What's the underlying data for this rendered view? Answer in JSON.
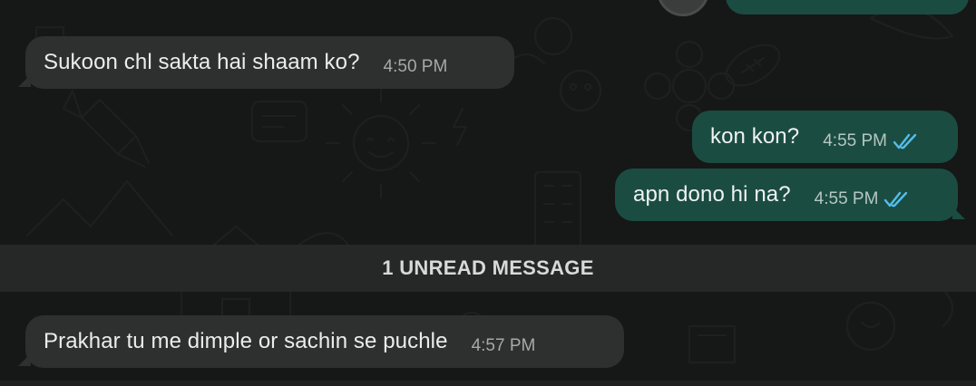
{
  "colors": {
    "background": "#161717",
    "incoming_bubble": "#2e2f2f",
    "outgoing_bubble": "#1b4c42",
    "read_ticks": "#53bdeb",
    "unread_bar": "#262828"
  },
  "messages": [
    {
      "direction": "incoming",
      "text": "Sukoon chl sakta hai shaam ko?",
      "time": "4:50 PM"
    },
    {
      "direction": "outgoing",
      "text": "kon kon?",
      "time": "4:55 PM",
      "status": "read"
    },
    {
      "direction": "outgoing",
      "text": "apn dono hi na?",
      "time": "4:55 PM",
      "status": "read"
    },
    {
      "direction": "incoming",
      "text": "Prakhar tu me dimple or sachin se puchle",
      "time": "4:57 PM"
    }
  ],
  "unread_divider": {
    "label": "1 UNREAD MESSAGE"
  },
  "icons": {
    "read_status": "double-check-icon",
    "partial_avatar": "avatar-icon"
  }
}
